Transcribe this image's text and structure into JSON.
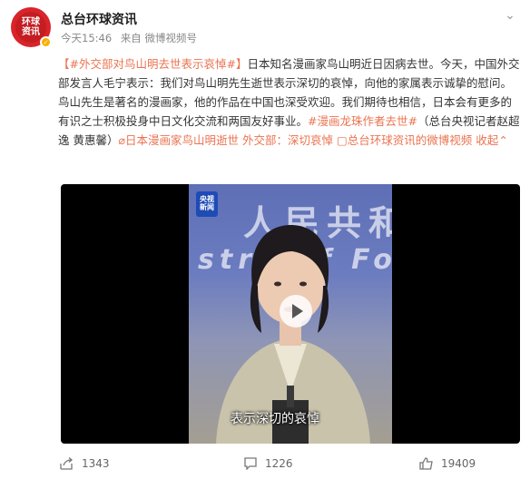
{
  "header": {
    "avatar_text_1": "环球",
    "avatar_text_2": "资讯",
    "account_name": "总台环球资讯",
    "time": "今天15:46",
    "source": "来自 微博视频号"
  },
  "post": {
    "tag": "#外交部对鸟山明去世表示哀悼#",
    "body": "日本知名漫画家鸟山明近日因病去世。今天，中国外交部发言人毛宁表示：我们对鸟山明先生逝世表示深切的哀悼，向他的家属表示诚挚的慰问。鸟山先生是著名的漫画家，他的作品在中国也深受欢迎。我们期待也相信，日本会有更多的有识之士积极投身中日文化交流和两国友好事业。",
    "tag2": "#漫画龙珠作者去世#",
    "reporters": "（总台央视记者赵超逸 黄惠馨）",
    "link1": "日本漫画家鸟山明逝世 外交部：深切哀悼",
    "link2": "总台环球资讯的微博视频",
    "collapse": "收起"
  },
  "video": {
    "wall_text_1": "人民共和",
    "wall_text_2": "stry of Fore",
    "logo_line1": "央视",
    "logo_line2": "新闻",
    "subtitle": "表示深切的哀悼"
  },
  "actions": {
    "share_count": "1343",
    "comment_count": "1226",
    "like_count": "19409"
  }
}
